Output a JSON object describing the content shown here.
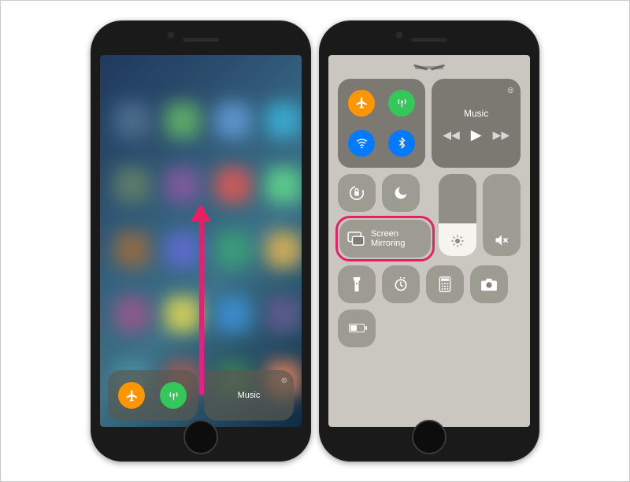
{
  "left": {
    "music_label": "Music",
    "toggles": {
      "airplane": {
        "color": "#ff9500"
      },
      "airdrop": {
        "color": "#34c759"
      }
    },
    "blobs": [
      "#4a6a8a",
      "#5aa56a",
      "#5a92c8",
      "#3aa5c8",
      "#5a7a6a",
      "#7a5a9a",
      "#c85a5a",
      "#5ac88a",
      "#8a6a4a",
      "#5a6ac8",
      "#3a9a7a",
      "#c8a85a",
      "#8a5a8a",
      "#c8c85a",
      "#3a8ac8",
      "#5a5a8a",
      "#4a8a9a",
      "#9a5a5a",
      "#3a7a5a",
      "#c87a5a"
    ]
  },
  "right": {
    "music_label": "Music",
    "screen_mirroring_label": "Screen\nMirroring",
    "toggles": {
      "airplane": {
        "color": "#ff9500"
      },
      "airdrop": {
        "color": "#34c759"
      },
      "wifi": {
        "color": "#007aff"
      },
      "bluetooth": {
        "color": "#007aff"
      }
    }
  }
}
